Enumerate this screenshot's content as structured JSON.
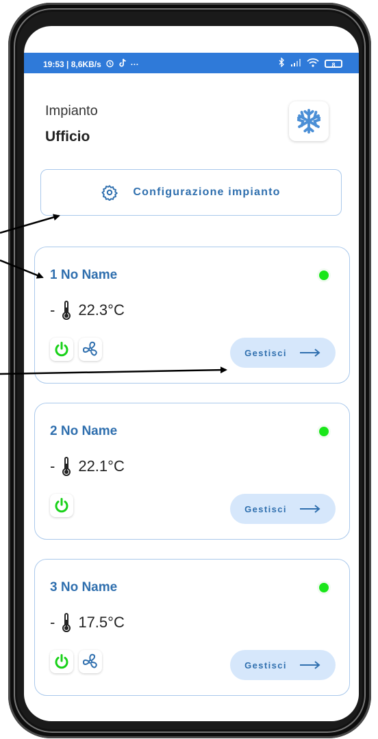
{
  "status_bar": {
    "left_text": "19:53 | 8,6KB/s",
    "ellipsis": "···",
    "battery": "8"
  },
  "header": {
    "label": "Impianto",
    "site_name": "Ufficio",
    "mode_icon": "snowflake-icon"
  },
  "config_button": {
    "label": "Configurazione impianto",
    "icon": "gear-icon"
  },
  "zones": [
    {
      "name": "1 No Name",
      "temp_prefix": "-",
      "temperature": "22.3°C",
      "status_color": "#19e619",
      "has_fan": true,
      "manage_label": "Gestisci"
    },
    {
      "name": "2 No Name",
      "temp_prefix": "-",
      "temperature": "22.1°C",
      "status_color": "#19e619",
      "has_fan": false,
      "manage_label": "Gestisci"
    },
    {
      "name": "3 No Name",
      "temp_prefix": "-",
      "temperature": "17.5°C",
      "status_color": "#19e619",
      "has_fan": true,
      "manage_label": "Gestisci"
    }
  ],
  "colors": {
    "accent": "#2f6fae",
    "status_bar": "#2f7ad9",
    "power": "#19d119",
    "manage_bg": "#d6e7fb"
  }
}
